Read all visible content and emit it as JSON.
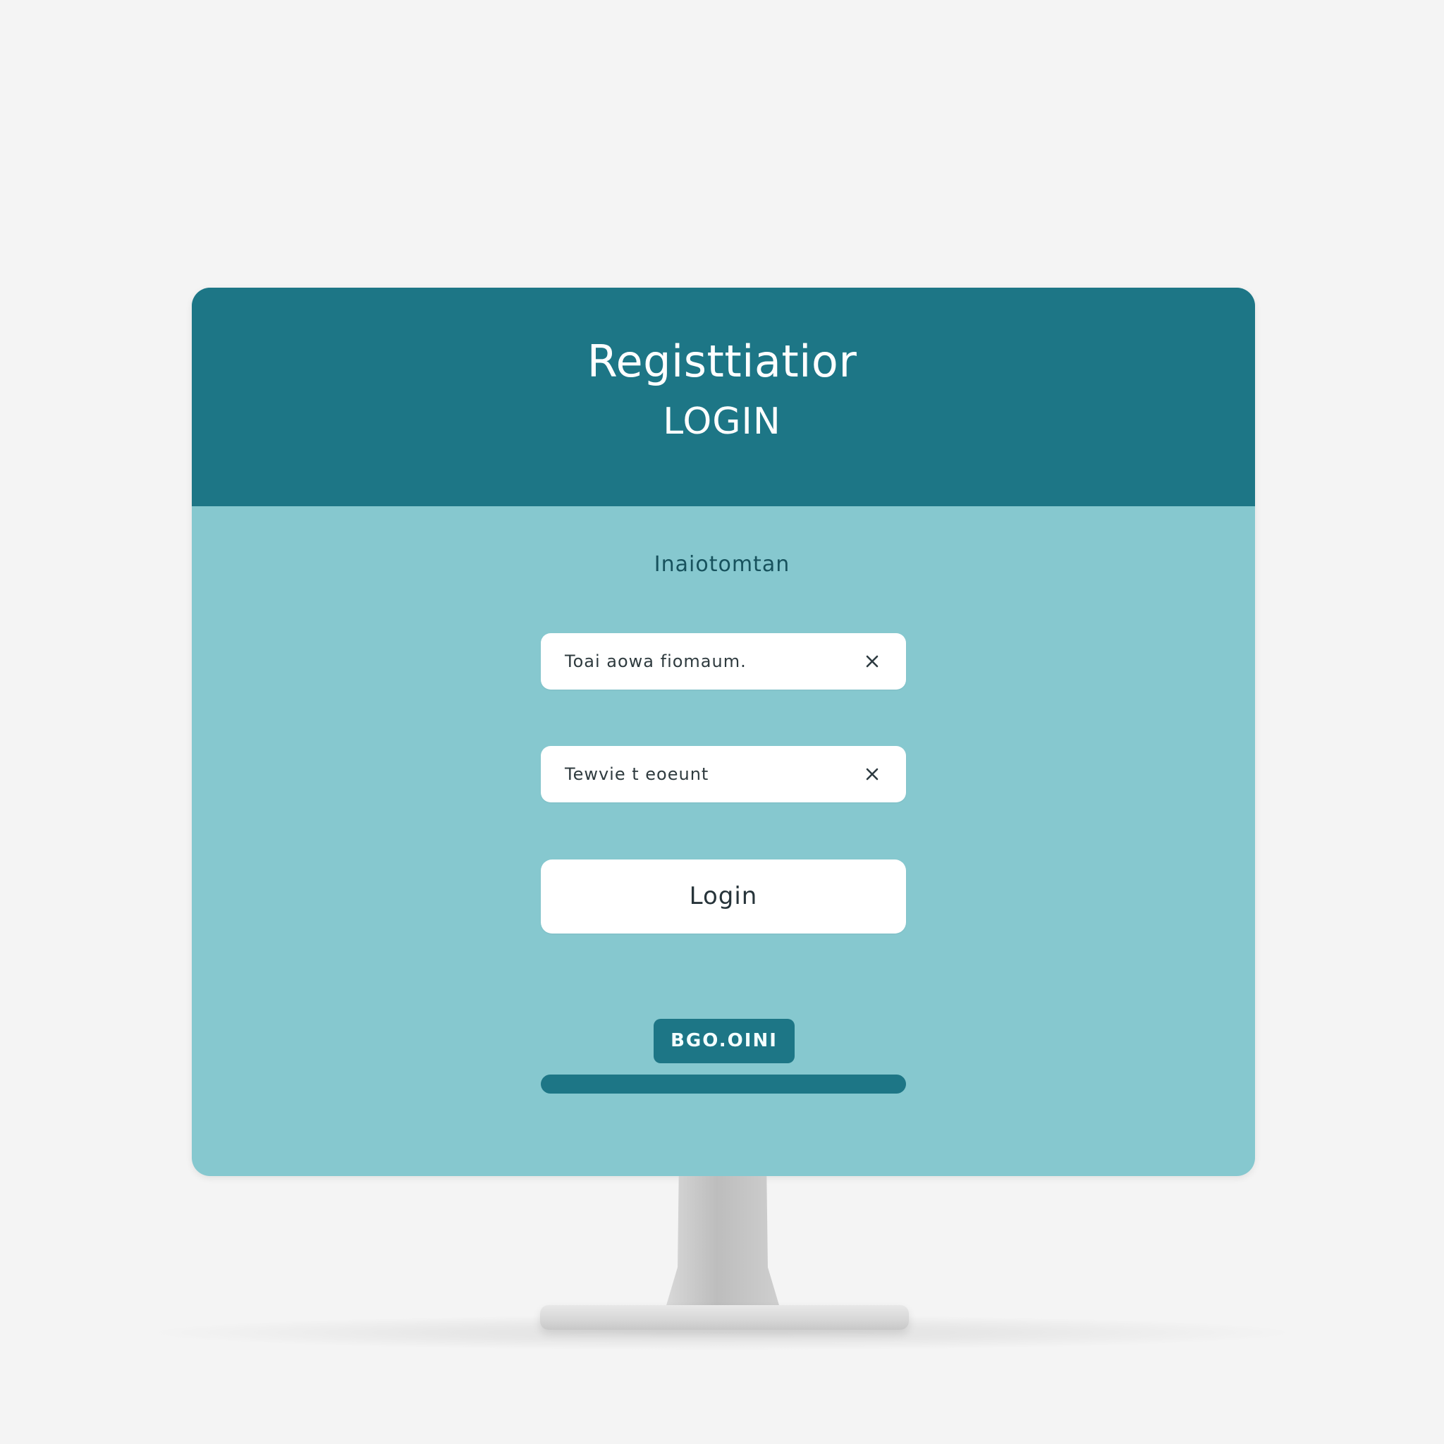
{
  "header": {
    "title": "Registtiatior",
    "subtitle": "LOGIN"
  },
  "form": {
    "section_label": "Inaiotomtan",
    "field_1": {
      "value": "Toai aowa fiomaum."
    },
    "field_2": {
      "value": "Tewvie t eoeunt"
    },
    "login_button": "Login",
    "secondary_button": "BGO.OINI"
  },
  "colors": {
    "header": "#1d7686",
    "screen": "#86c8cf",
    "button_primary": "#ffffff",
    "button_secondary": "#1d7686"
  },
  "icons": {
    "field_1": "close-icon",
    "field_2": "close-icon"
  }
}
